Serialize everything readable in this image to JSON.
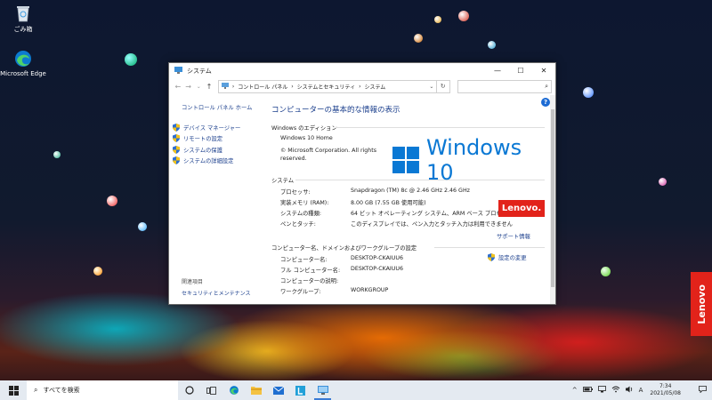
{
  "desktop": {
    "icons": [
      {
        "label": "ごみ箱",
        "icon": "recycle-bin-icon"
      },
      {
        "label": "Microsoft Edge",
        "icon": "edge-icon"
      }
    ],
    "side_brand": "Lenovo"
  },
  "window": {
    "title": "システム",
    "title_icon": "system-icon",
    "buttons": {
      "minimize": "—",
      "maximize": "☐",
      "close": "✕"
    },
    "breadcrumb": [
      "コントロール パネル",
      "システムとセキュリティ",
      "システム"
    ],
    "breadcrumb_sep": "›",
    "nav": {
      "back": "←",
      "forward": "→",
      "up": "↑",
      "dropdown": "⌄",
      "refresh": "↻",
      "search_icon": "⌕"
    }
  },
  "sidebar": {
    "home": "コントロール パネル ホーム",
    "items": [
      "デバイス マネージャー",
      "リモートの設定",
      "システムの保護",
      "システムの詳細設定"
    ],
    "related_heading": "関連項目",
    "related_link": "セキュリティとメンテナンス"
  },
  "main": {
    "heading": "コンピューターの基本的な情報の表示",
    "edition_section": "Windows のエディション",
    "edition_name": "Windows 10 Home",
    "copyright_line1": "© Microsoft Corporation. All rights",
    "copyright_line2": "reserved.",
    "windows_logo_text": "Windows 10",
    "system_section": "システム",
    "system_rows": [
      {
        "label": "プロセッサ:",
        "value": "Snapdragon (TM) 8c @ 2.46 GHz   2.46 GHz"
      },
      {
        "label": "実装メモリ (RAM):",
        "value": "8.00 GB (7.55 GB 使用可能)"
      },
      {
        "label": "システムの種類:",
        "value": "64 ビット オペレーティング システム、ARM ベース プロセッサ"
      },
      {
        "label": "ペンとタッチ:",
        "value": "このディスプレイでは、ペン入力とタッチ入力は利用できません"
      }
    ],
    "oem_logo": "Lenovo.",
    "support_link": "サポート情報",
    "computer_section": "コンピューター名、ドメインおよびワークグループの設定",
    "computer_rows": [
      {
        "label": "コンピューター名:",
        "value": "DESKTOP-CKAIUU6"
      },
      {
        "label": "フル コンピューター名:",
        "value": "DESKTOP-CKAIUU6"
      },
      {
        "label": "コンピューターの説明:",
        "value": ""
      },
      {
        "label": "ワークグループ:",
        "value": "WORKGROUP"
      }
    ],
    "change_settings": "設定の変更",
    "help_icon": "?"
  },
  "taskbar": {
    "search_placeholder": "すべてを検索",
    "icons": [
      "cortana-icon",
      "task-view-icon",
      "edge-icon",
      "file-explorer-icon",
      "mail-icon",
      "lenovo-app-icon",
      "control-panel-icon"
    ],
    "tray": {
      "chevron": "^",
      "ime": "A",
      "time": "7:34",
      "date": "2021/05/08"
    }
  },
  "colors": {
    "link": "#1a3e8c",
    "windows_blue": "#0a78d4",
    "lenovo_red": "#e2231a",
    "taskbar": "#e4eaf1"
  }
}
